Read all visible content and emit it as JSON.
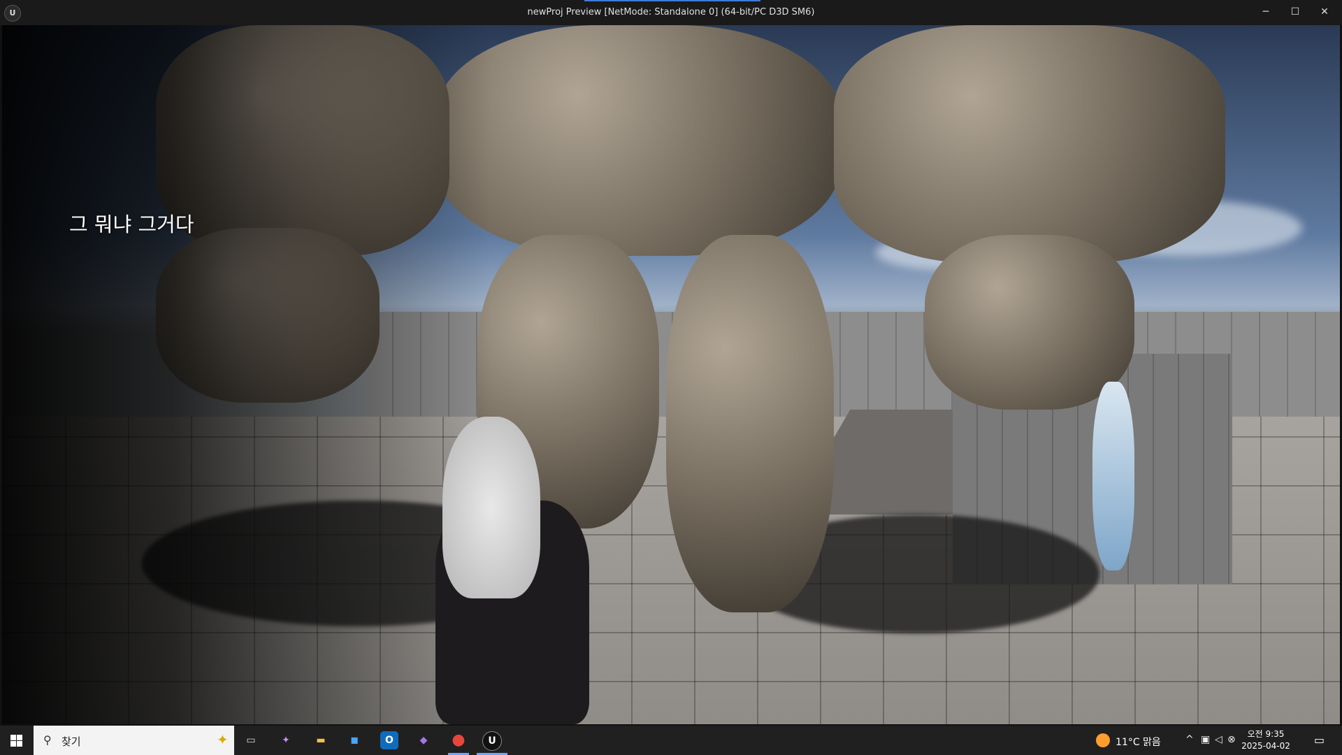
{
  "window": {
    "title": "newProj Preview [NetMode: Standalone 0]  (64-bit/PC D3D SM6)",
    "app_icon": "unreal-engine-icon",
    "controls": {
      "minimize": "─",
      "maximize": "☐",
      "close": "✕"
    }
  },
  "game": {
    "subtitle": "그 뭐냐 그거다"
  },
  "taskbar": {
    "start_icon": "windows-start-icon",
    "search": {
      "placeholder": "찾기",
      "icon": "search-icon"
    },
    "apps": [
      {
        "name": "task-view",
        "glyph": "▭"
      },
      {
        "name": "copilot",
        "glyph": "✦"
      },
      {
        "name": "file-explorer",
        "glyph": "▬"
      },
      {
        "name": "microsoft-store",
        "glyph": "◼"
      },
      {
        "name": "outlook",
        "glyph": "O"
      },
      {
        "name": "visual-studio",
        "glyph": "◆"
      },
      {
        "name": "chrome",
        "glyph": "●"
      },
      {
        "name": "unreal-engine",
        "glyph": "U"
      }
    ],
    "tray": {
      "weather": "11°C  맑음",
      "time": "오전 9:35",
      "date": "2025-04-02"
    }
  },
  "colors": {
    "accent": "#3d7bd9",
    "taskbar_bg": "#202020",
    "titlebar_bg": "#1a1a1a"
  }
}
